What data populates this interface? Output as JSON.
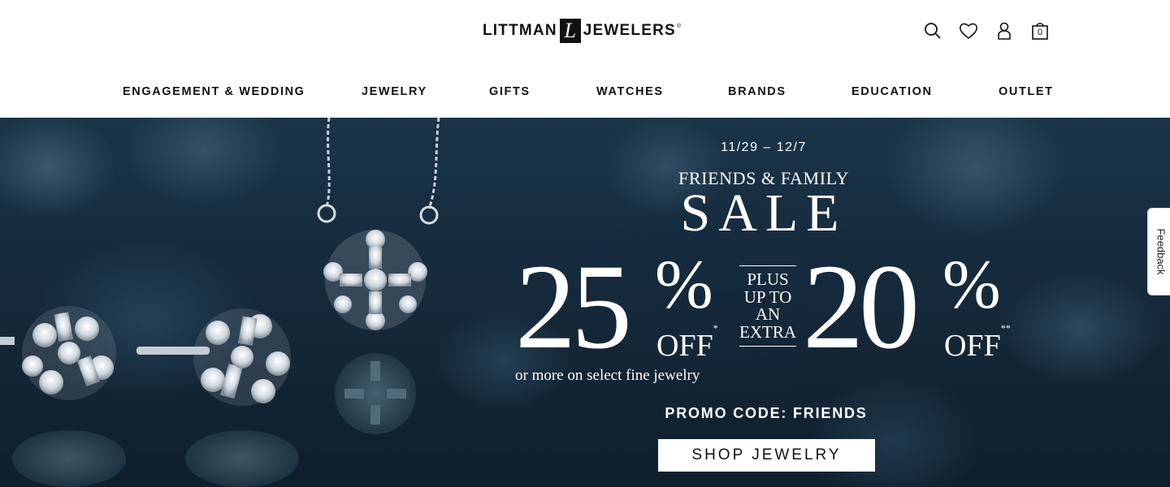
{
  "header": {
    "logo": {
      "left_text": "LITTMAN",
      "mark": "L",
      "right_text": "JEWELERS",
      "reg": "®"
    },
    "icons": {
      "search": "search-icon",
      "wishlist": "heart-icon",
      "account": "user-icon",
      "cart": "shopping-bag-icon",
      "cart_count": "0"
    },
    "nav": [
      {
        "label": "ENGAGEMENT & WEDDING"
      },
      {
        "label": "JEWELRY"
      },
      {
        "label": "GIFTS"
      },
      {
        "label": "WATCHES"
      },
      {
        "label": "BRANDS"
      },
      {
        "label": "EDUCATION"
      },
      {
        "label": "OUTLET"
      }
    ]
  },
  "hero": {
    "date_range": "11/29 – 12/7",
    "headline_small": "FRIENDS & FAMILY",
    "headline_big": "SALE",
    "offer1": {
      "number": "25",
      "percent": "%",
      "off": "OFF",
      "mark": "*"
    },
    "plus_text": [
      "PLUS",
      "UP TO",
      "AN",
      "EXTRA"
    ],
    "offer2": {
      "number": "20",
      "percent": "%",
      "off": "OFF",
      "mark": "**"
    },
    "fine_print": "or more on select fine jewelry",
    "promo_code": "PROMO CODE: FRIENDS",
    "cta_label": "SHOP JEWELRY",
    "background_color": "#15293a"
  },
  "feedback_tab": {
    "label": "Feedback"
  }
}
